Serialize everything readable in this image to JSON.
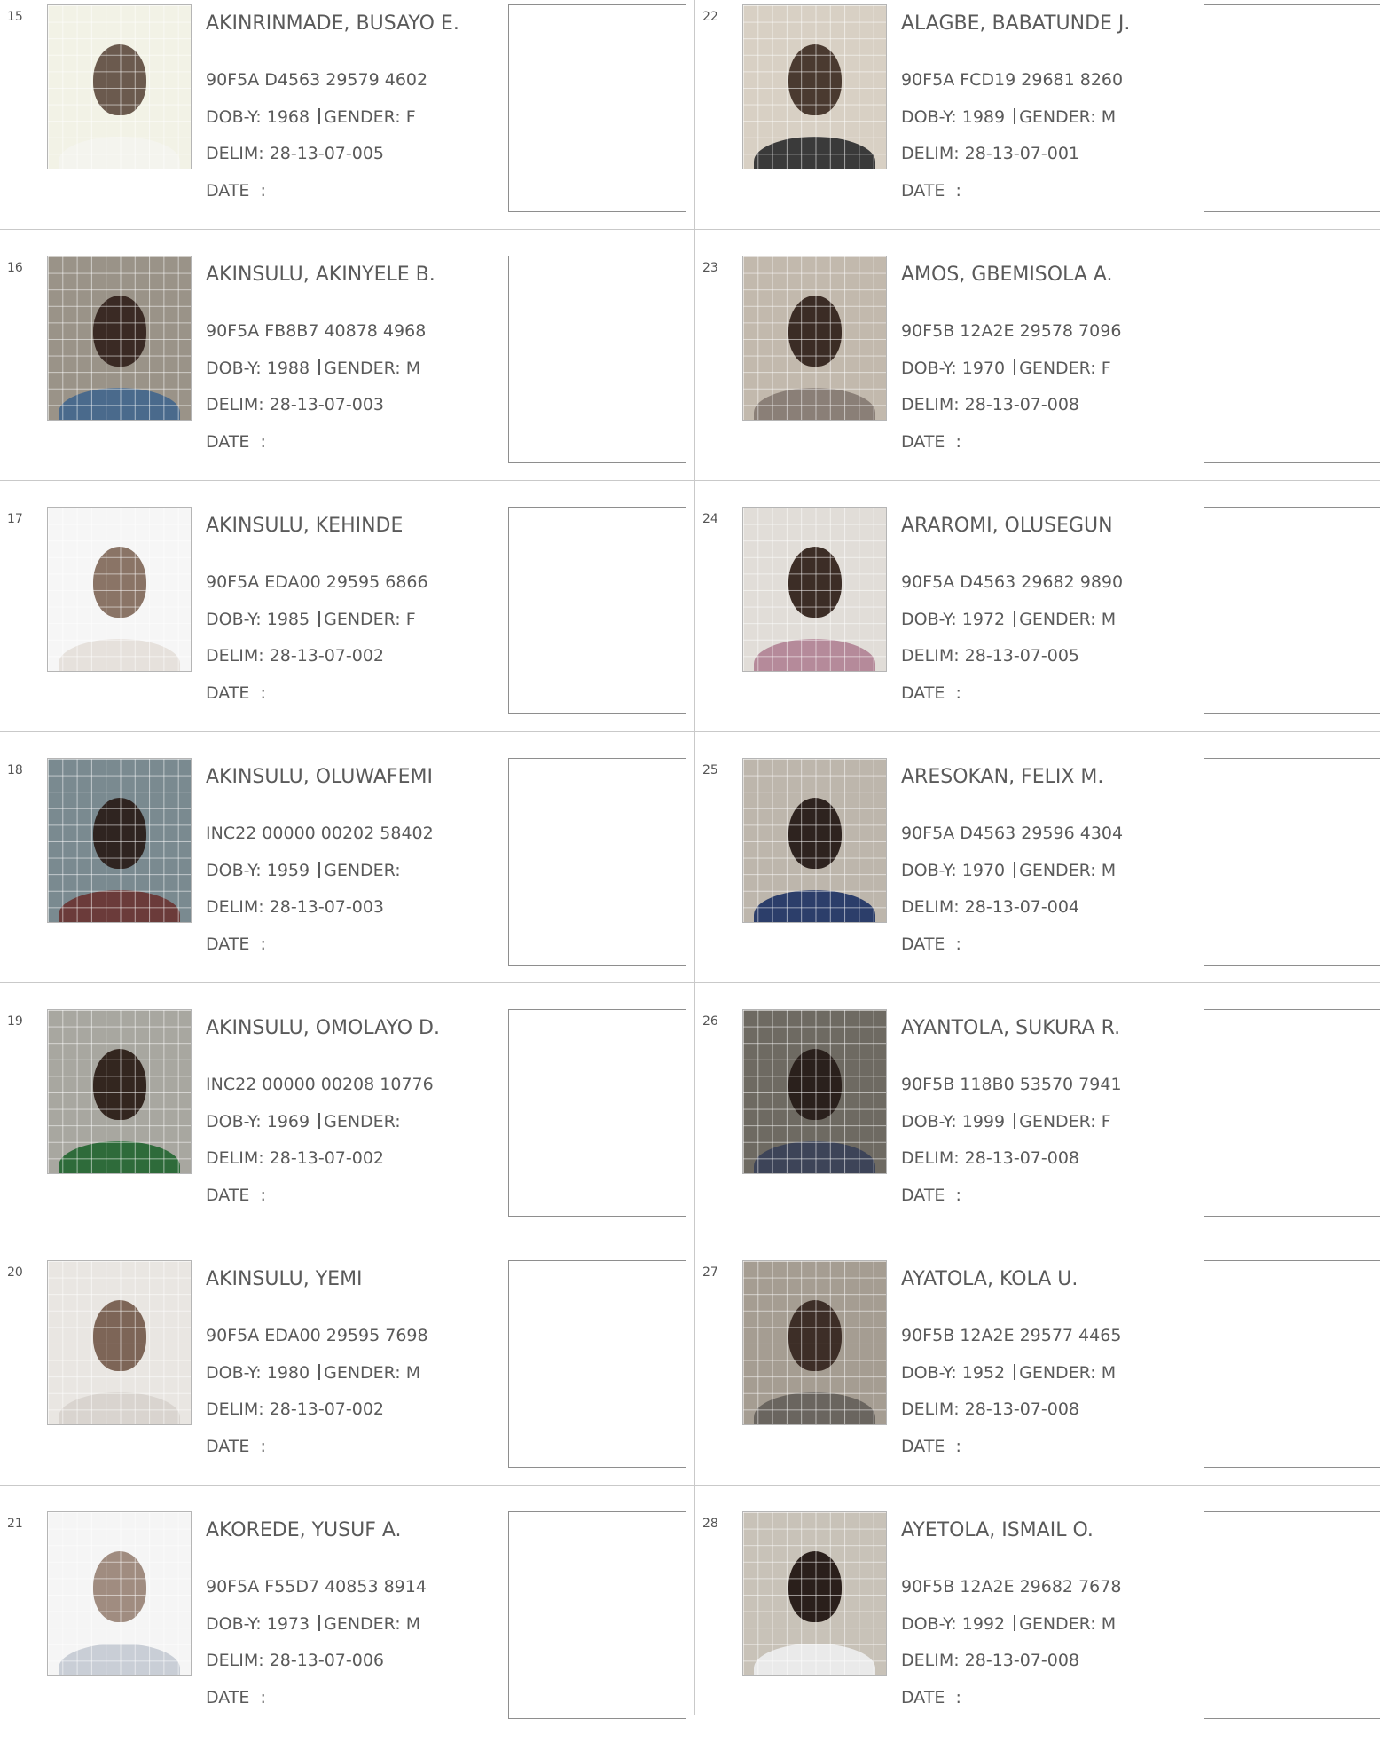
{
  "records": [
    {
      "num": "15",
      "name": "AKINRINMADE, BUSAYO E.",
      "vin": "90F5A D4563 29579 4602",
      "dob_label": "DOB-Y: 1968",
      "gender_label": "GENDER: F",
      "delim": "DELIM: 28-13-07-005",
      "date_label": "DATE  :"
    },
    {
      "num": "16",
      "name": "AKINSULU, AKINYELE B.",
      "vin": "90F5A FB8B7 40878 4968",
      "dob_label": "DOB-Y: 1988",
      "gender_label": "GENDER: M",
      "delim": "DELIM: 28-13-07-003",
      "date_label": "DATE  :"
    },
    {
      "num": "17",
      "name": "AKINSULU, KEHINDE",
      "vin": "90F5A EDA00 29595 6866",
      "dob_label": "DOB-Y: 1985",
      "gender_label": "GENDER: F",
      "delim": "DELIM: 28-13-07-002",
      "date_label": "DATE  :"
    },
    {
      "num": "18",
      "name": "AKINSULU, OLUWAFEMI",
      "vin": "INC22 00000 00202 58402",
      "dob_label": "DOB-Y: 1959",
      "gender_label": "GENDER:",
      "delim": "DELIM: 28-13-07-003",
      "date_label": "DATE  :"
    },
    {
      "num": "19",
      "name": "AKINSULU, OMOLAYO D.",
      "vin": "INC22 00000 00208 10776",
      "dob_label": "DOB-Y: 1969",
      "gender_label": "GENDER:",
      "delim": "DELIM: 28-13-07-002",
      "date_label": "DATE  :"
    },
    {
      "num": "20",
      "name": "AKINSULU, YEMI",
      "vin": "90F5A EDA00 29595 7698",
      "dob_label": "DOB-Y: 1980",
      "gender_label": "GENDER: M",
      "delim": "DELIM: 28-13-07-002",
      "date_label": "DATE  :"
    },
    {
      "num": "21",
      "name": "AKOREDE, YUSUF A.",
      "vin": "90F5A F55D7 40853 8914",
      "dob_label": "DOB-Y: 1973",
      "gender_label": "GENDER: M",
      "delim": "DELIM: 28-13-07-006",
      "date_label": "DATE  :"
    },
    {
      "num": "22",
      "name": "ALAGBE, BABATUNDE J.",
      "vin": "90F5A FCD19 29681 8260",
      "dob_label": "DOB-Y: 1989",
      "gender_label": "GENDER: M",
      "delim": "DELIM: 28-13-07-001",
      "date_label": "DATE  :"
    },
    {
      "num": "23",
      "name": "AMOS, GBEMISOLA A.",
      "vin": "90F5B 12A2E 29578 7096",
      "dob_label": "DOB-Y: 1970",
      "gender_label": "GENDER: F",
      "delim": "DELIM: 28-13-07-008",
      "date_label": "DATE  :"
    },
    {
      "num": "24",
      "name": "ARAROMI, OLUSEGUN",
      "vin": "90F5A D4563 29682 9890",
      "dob_label": "DOB-Y: 1972",
      "gender_label": "GENDER: M",
      "delim": "DELIM: 28-13-07-005",
      "date_label": "DATE  :"
    },
    {
      "num": "25",
      "name": "ARESOKAN, FELIX M.",
      "vin": "90F5A D4563 29596 4304",
      "dob_label": "DOB-Y: 1970",
      "gender_label": "GENDER: M",
      "delim": "DELIM: 28-13-07-004",
      "date_label": "DATE  :"
    },
    {
      "num": "26",
      "name": "AYANTOLA, SUKURA R.",
      "vin": "90F5B 118B0 53570 7941",
      "dob_label": "DOB-Y: 1999",
      "gender_label": "GENDER: F",
      "delim": "DELIM: 28-13-07-008",
      "date_label": "DATE  :"
    },
    {
      "num": "27",
      "name": "AYATOLA, KOLA U.",
      "vin": "90F5B 12A2E 29577 4465",
      "dob_label": "DOB-Y: 1952",
      "gender_label": "GENDER: M",
      "delim": "DELIM: 28-13-07-008",
      "date_label": "DATE  :"
    },
    {
      "num": "28",
      "name": "AYETOLA, ISMAIL O.",
      "vin": "90F5B 12A2E 29682 7678",
      "dob_label": "DOB-Y: 1992",
      "gender_label": "GENDER: M",
      "delim": "DELIM: 28-13-07-008",
      "date_label": "DATE  :"
    }
  ],
  "photo_colors": [
    {
      "bg": "#f2f2e6",
      "face": "#6b5a4e",
      "body": "#f4f4ee"
    },
    {
      "bg": "#9a9388",
      "face": "#3a2a24",
      "body": "#4a6a8c"
    },
    {
      "bg": "#f6f6f6",
      "face": "#8a7466",
      "body": "#e6e1dc"
    },
    {
      "bg": "#7a8a90",
      "face": "#2f2420",
      "body": "#6b3b3a"
    },
    {
      "bg": "#a8a7a0",
      "face": "#33261f",
      "body": "#2e6b3a"
    },
    {
      "bg": "#e9e6e2",
      "face": "#7d6557",
      "body": "#d9d4cf"
    },
    {
      "bg": "#f5f5f5",
      "face": "#a08c80",
      "body": "#c9ced6"
    },
    {
      "bg": "#d8d0c4",
      "face": "#4a3a30",
      "body": "#3a3a3a"
    },
    {
      "bg": "#c2b9ad",
      "face": "#3b2c25",
      "body": "#8a7f77"
    },
    {
      "bg": "#e1ddd8",
      "face": "#3c2d26",
      "body": "#b58a9a"
    },
    {
      "bg": "#bdb6ac",
      "face": "#2e231f",
      "body": "#2c3e6a"
    },
    {
      "bg": "#6e6a62",
      "face": "#2a201c",
      "body": "#3d4458"
    },
    {
      "bg": "#a59d92",
      "face": "#3d2e27",
      "body": "#6a655f"
    },
    {
      "bg": "#c8c2b8",
      "face": "#2a1f1b",
      "body": "#eaeaea"
    }
  ]
}
